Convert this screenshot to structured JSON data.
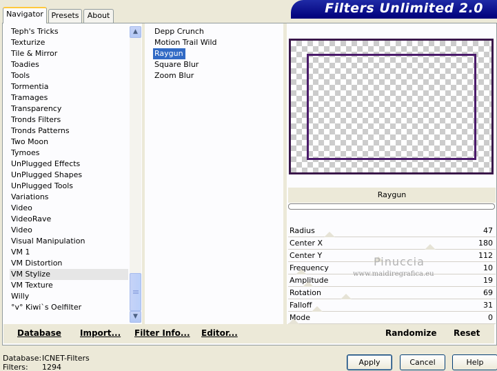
{
  "tabs": [
    "Navigator",
    "Presets",
    "About"
  ],
  "app_title": "Filters Unlimited 2.0",
  "categories": [
    "Teph's Tricks",
    "Texturize",
    "Tile & Mirror",
    "Toadies",
    "Tools",
    "Tormentia",
    "Tramages",
    "Transparency",
    "Tronds Filters",
    "Tronds Patterns",
    "Two Moon",
    "Tymoes",
    "UnPlugged Effects",
    "UnPlugged Shapes",
    "UnPlugged Tools",
    "Variations",
    "Video",
    "VideoRave",
    "Video",
    "Visual Manipulation",
    "VM 1",
    "VM Distortion",
    "VM Stylize",
    "VM Texture",
    "Willy",
    "°v° Kiwi`s Oelfilter"
  ],
  "selected_category": "VM Stylize",
  "filters": [
    "Depp Crunch",
    "Motion Trail Wild",
    "Raygun",
    "Square Blur",
    "Zoom Blur"
  ],
  "selected_filter": "Raygun",
  "preview_filter_name": "Raygun",
  "params": [
    {
      "label": "Radius",
      "value": "47",
      "level": 47
    },
    {
      "label": "Center X",
      "value": "180",
      "level": 180
    },
    {
      "label": "Center Y",
      "value": "112",
      "level": 112
    },
    {
      "label": "Frequency",
      "value": "10",
      "level": 10
    },
    {
      "label": "Amplitude",
      "value": "19",
      "level": 19
    },
    {
      "label": "Rotation",
      "value": "69",
      "level": 69
    },
    {
      "label": "Falloff",
      "value": "31",
      "level": 31
    },
    {
      "label": "Mode",
      "value": "0",
      "level": 0
    }
  ],
  "watermark": {
    "name": "Pinuccia",
    "site": "www.maidiregrafica.eu"
  },
  "left_buttons": {
    "database": "Database",
    "import": "Import...",
    "filter_info": "Filter Info...",
    "editor": "Editor..."
  },
  "right_buttons": {
    "randomize": "Randomize",
    "reset": "Reset"
  },
  "status": {
    "database_label": "Database:",
    "database_value": "ICNET-Filters",
    "filters_label": "Filters:",
    "filters_value": "1294"
  },
  "dialog_buttons": {
    "apply": "Apply",
    "cancel": "Cancel",
    "help": "Help"
  },
  "colors": {
    "accent": "#316ac5",
    "frame": "#3a174a",
    "banner": "#00007a"
  }
}
